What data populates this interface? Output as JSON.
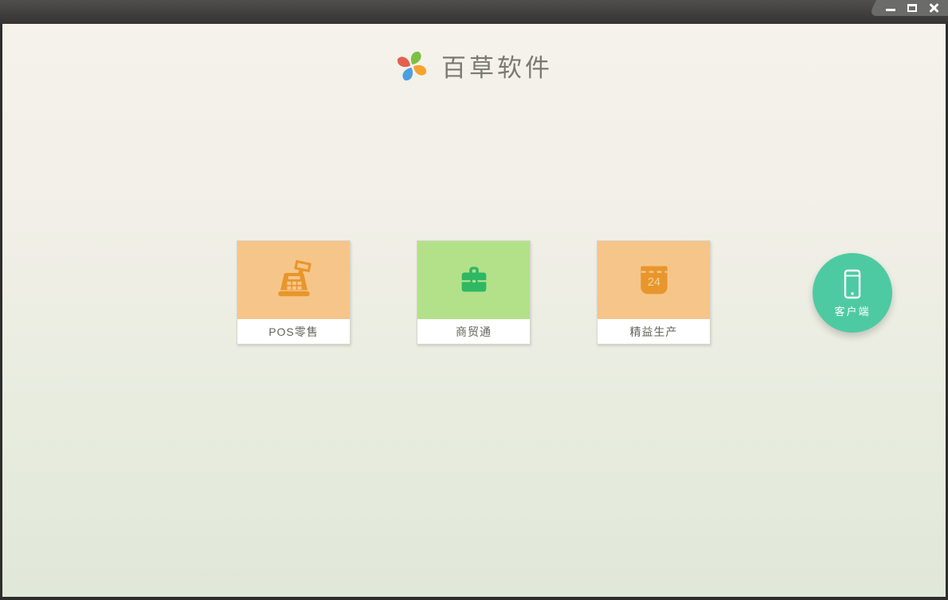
{
  "header": {
    "app_title": "百草软件"
  },
  "products": [
    {
      "label": "POS零售",
      "icon": "cash-register-icon",
      "tile_color": "#f6c589",
      "icon_color": "#e8962b"
    },
    {
      "label": "商贸通",
      "icon": "briefcase-icon",
      "tile_color": "#b2e18a",
      "icon_color": "#2fb764"
    },
    {
      "label": "精益生产",
      "icon": "calendar-icon",
      "tile_color": "#f6c589",
      "icon_color": "#e8962b",
      "day": "24"
    }
  ],
  "client_button": {
    "label": "客户端",
    "icon": "smartphone-icon",
    "color": "#4ecaa3"
  },
  "theme": {
    "titlebar_color": "#413f3e",
    "titlebar_tab_color": "#6b6b69",
    "background_top": "#f4f2ea",
    "background_bottom": "#e0e8d9",
    "title_text_color": "#7a7a72",
    "label_text_color": "#65655e",
    "logo_petal_colors": [
      "#7bc143",
      "#f6a22d",
      "#4e9fdf",
      "#e4604e"
    ]
  }
}
